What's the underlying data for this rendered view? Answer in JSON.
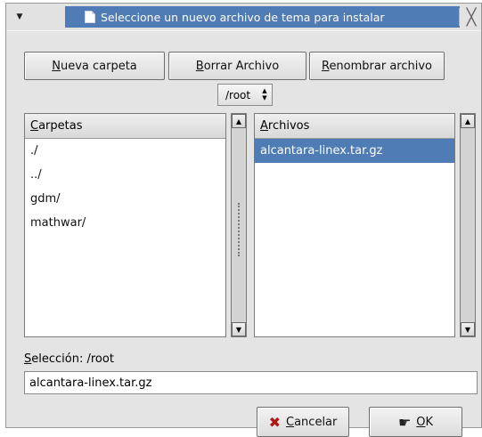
{
  "window": {
    "title": "Seleccione un nuevo archivo de tema para instalar",
    "menu_glyph": "▼",
    "close_glyph": "╳"
  },
  "toolbar": {
    "new_folder": {
      "pre": "",
      "ul": "N",
      "post": "ueva carpeta"
    },
    "delete_file": {
      "pre": "",
      "ul": "B",
      "post": "orrar Archivo"
    },
    "rename_file": {
      "pre": "",
      "ul": "R",
      "post": "enombrar archivo"
    }
  },
  "path_combo": {
    "value": "/root"
  },
  "folders": {
    "header": {
      "ul": "C",
      "post": "arpetas"
    },
    "items": [
      "./",
      "../",
      "gdm/",
      "mathwar/"
    ]
  },
  "files": {
    "header": {
      "ul": "A",
      "post": "rchivos"
    },
    "items": [
      "alcantara-linex.tar.gz"
    ],
    "selected_index": 0
  },
  "selection": {
    "label_ul": "S",
    "label_post": "elección: /root",
    "value": "alcantara-linex.tar.gz"
  },
  "buttons": {
    "cancel": {
      "ul": "C",
      "post": "ancelar"
    },
    "ok": {
      "ul": "O",
      "post": "K"
    }
  },
  "colors": {
    "title_bar": "#4f7cb4",
    "selection": "#4f7cb4",
    "window_bg": "#e4e4e4"
  },
  "icons": {
    "cancel": "cross-icon",
    "ok": "ok-hand-icon",
    "title": "document-icon"
  }
}
